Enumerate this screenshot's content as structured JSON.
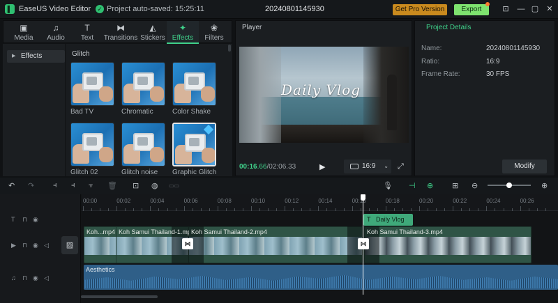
{
  "titlebar": {
    "app_name": "EaseUS Video Editor",
    "autosave_text": "Project auto-saved: 15:25:11",
    "project_name": "20240801145930",
    "get_pro_label": "Get Pro Version",
    "export_label": "Export"
  },
  "tabs": [
    {
      "label": "Media",
      "icon": "media-icon",
      "glyph": "▣"
    },
    {
      "label": "Audio",
      "icon": "audio-icon",
      "glyph": "♫"
    },
    {
      "label": "Text",
      "icon": "text-icon",
      "glyph": "T"
    },
    {
      "label": "Transitions",
      "icon": "transitions-icon",
      "glyph": "⧓"
    },
    {
      "label": "Stickers",
      "icon": "stickers-icon",
      "glyph": "◭"
    },
    {
      "label": "Effects",
      "icon": "effects-icon",
      "glyph": "✦",
      "active": true
    },
    {
      "label": "Filters",
      "icon": "filters-icon",
      "glyph": "❀"
    }
  ],
  "effects_sidebar": {
    "item": "Effects"
  },
  "effects_grid": {
    "category": "Glitch",
    "items": [
      "Bad TV",
      "Chromatic",
      "Color Shake",
      "Glitch 02",
      "Glitch noise",
      "Graphic Glitch"
    ]
  },
  "player": {
    "title": "Player",
    "overlay_text": "Daily  Vlog",
    "current_time_main": "00:16",
    "current_time_frac": ".66",
    "total_time": "/02:06.33",
    "aspect_ratio": "16:9"
  },
  "project_details": {
    "title": "Project Details",
    "name_label": "Name:",
    "name_value": "20240801145930",
    "ratio_label": "Ratio:",
    "ratio_value": "16:9",
    "framerate_label": "Frame Rate:",
    "framerate_value": "30 FPS",
    "modify_label": "Modify"
  },
  "timeline": {
    "ruler_ticks": [
      "00:00",
      "00:02",
      "00:04",
      "00:06",
      "00:08",
      "00:10",
      "00:12",
      "00:14",
      "00:16",
      "00:18",
      "00:20",
      "00:22",
      "00:24",
      "00:26"
    ],
    "title_clip": "Daily Vlog",
    "video_clips": [
      "Koh...mp4",
      "Koh Samui Thailand-1.mp4",
      "Koh Samui Thailand-2.mp4",
      "Koh Samui Thailand-3.mp4"
    ],
    "audio_clip": "Aesthetics"
  },
  "colors": {
    "accent": "#3fd18a",
    "pro_button": "#c98a1e",
    "export_button": "#7ee36f",
    "video_track": "#2b4a3e",
    "audio_track": "#2f5f88"
  }
}
